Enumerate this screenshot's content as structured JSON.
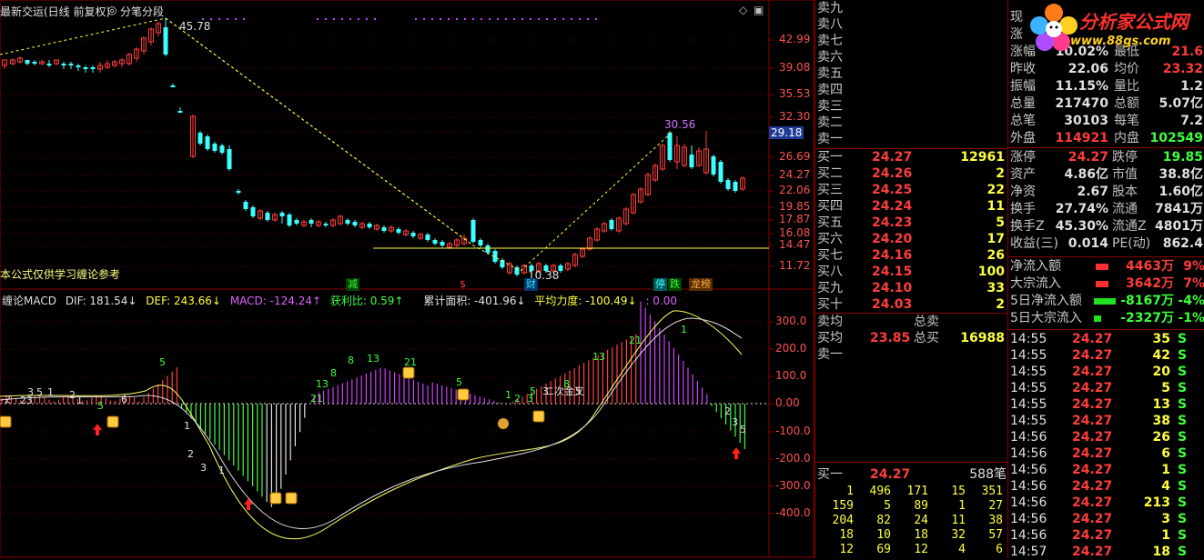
{
  "chart": {
    "header_title": "最新交运(日线 前复权)",
    "header_mode": "分笔分段",
    "notice": "本公式仅供学习缠论参考",
    "price_high_label": "45.78",
    "price_low_label": "10.38",
    "recent_high_label": "30.56",
    "current_price_tag": "29.18",
    "price_axis": [
      "42.99",
      "39.08",
      "35.53",
      "32.30",
      "29.18",
      "26.69",
      "24.27",
      "22.06",
      "19.85",
      "17.87",
      "16.08",
      "14.47",
      "11.72"
    ],
    "macd_axis": [
      "300.0",
      "200.0",
      "100.0",
      "0.00",
      "-100.0",
      "-200.0",
      "-300.0",
      "-400.0"
    ],
    "signal_tags": {
      "reduce": "减",
      "sell": "$",
      "fin": "财",
      "limit_up": "停",
      "drop": "跌",
      "dragon": "龙榜"
    },
    "macd_header": {
      "name": "缠论MACD",
      "dif": "DIF: 181.54↓",
      "def": "DEF: 243.66↓",
      "macd": "MACD: -124.24↑",
      "profit": "获利比: 0.59↑",
      "area": "累计面积: -401.96↓",
      "force": "平均力度: -100.49↓",
      "extra": ": 0.00"
    },
    "macd_annotations": [
      "5",
      "5",
      "8",
      "13",
      "21",
      "5",
      "8",
      "13",
      "21",
      "1",
      "2",
      "3",
      "5",
      "8",
      "13",
      "21",
      "1",
      "2",
      "3",
      "5",
      "1",
      "2",
      "3",
      "5",
      "二次金叉",
      "1",
      "2",
      "3",
      "1",
      "2",
      "3",
      "5",
      "6",
      "1",
      "23"
    ]
  },
  "orderbook": {
    "sell_labels": [
      "卖九",
      "卖八",
      "卖七",
      "卖六",
      "卖五",
      "卖四",
      "卖三",
      "卖二",
      "卖一"
    ],
    "buy_rows": [
      {
        "label": "买一",
        "price": "24.27",
        "vol": "12961"
      },
      {
        "label": "买二",
        "price": "24.26",
        "vol": "2"
      },
      {
        "label": "买三",
        "price": "24.25",
        "vol": "22"
      },
      {
        "label": "买四",
        "price": "24.24",
        "vol": "11"
      },
      {
        "label": "买五",
        "price": "24.23",
        "vol": "5"
      },
      {
        "label": "买六",
        "price": "24.20",
        "vol": "17"
      },
      {
        "label": "买七",
        "price": "24.16",
        "vol": "26"
      },
      {
        "label": "买八",
        "price": "24.15",
        "vol": "100"
      },
      {
        "label": "买九",
        "price": "24.10",
        "vol": "33"
      },
      {
        "label": "买十",
        "price": "24.03",
        "vol": "2"
      }
    ],
    "sell_avg_label": "卖均",
    "total_sell_label": "总卖",
    "buy_avg_label": "买均",
    "buy_avg_value": "23.85",
    "total_buy_label": "总买",
    "total_buy_value": "16988",
    "sell1_label": "卖一",
    "bottom_buy1_label": "买一",
    "bottom_buy1_price": "24.27",
    "bottom_buy1_count": "588笔",
    "queue": [
      [
        "1",
        "496",
        "171",
        "15",
        "351"
      ],
      [
        "159",
        "5",
        "89",
        "1",
        "27"
      ],
      [
        "204",
        "82",
        "24",
        "11",
        "38"
      ],
      [
        "18",
        "10",
        "18",
        "32",
        "57"
      ],
      [
        "12",
        "69",
        "12",
        "4",
        "6"
      ]
    ]
  },
  "quote": {
    "logo_text": "分析家公式网",
    "logo_url": "www.88gs.com",
    "rows": [
      {
        "a": "现",
        "b": "",
        "c": "",
        "d": ""
      },
      {
        "a": "涨",
        "b": "",
        "c": "",
        "d": ""
      },
      {
        "a": "涨幅",
        "b": "10.02%",
        "c": "最低",
        "d": "21.6"
      },
      {
        "a": "昨收",
        "b": "22.06",
        "c": "均价",
        "d": "23.32"
      },
      {
        "a": "振幅",
        "b": "11.15%",
        "c": "量比",
        "d": "1.2"
      },
      {
        "a": "总量",
        "b": "217470",
        "c": "总额",
        "d": "5.07亿"
      },
      {
        "a": "总笔",
        "b": "30103",
        "c": "每笔",
        "d": "7.2"
      },
      {
        "a": "外盘",
        "b": "114921",
        "c": "内盘",
        "d": "102549"
      }
    ],
    "rows2": [
      {
        "a": "涨停",
        "b": "24.27",
        "c": "跌停",
        "d": "19.85"
      },
      {
        "a": "资产",
        "b": "4.86亿",
        "c": "市值",
        "d": "38.8亿"
      },
      {
        "a": "净资",
        "b": "2.67",
        "c": "股本",
        "d": "1.60亿"
      },
      {
        "a": "换手",
        "b": "27.74%",
        "c": "流通",
        "d": "7841万"
      },
      {
        "a": "换手Z",
        "b": "45.30%",
        "c": "流通Z",
        "d": "4801万"
      },
      {
        "a": "收益(三)",
        "b": "0.014",
        "c": "PE(动)",
        "d": "862.4"
      }
    ],
    "flows": [
      {
        "label": "净流入额",
        "value": "4463万",
        "tail": "9%"
      },
      {
        "label": "大宗流入",
        "value": "3642万",
        "tail": "7%"
      },
      {
        "label": "5日净流入额",
        "value": "-8167万",
        "tail": "-4%"
      },
      {
        "label": "5日大宗流入",
        "value": "-2327万",
        "tail": "-1%"
      }
    ],
    "ticks": [
      {
        "t": "14:55",
        "p": "24.27",
        "v": "35",
        "s": "S"
      },
      {
        "t": "14:55",
        "p": "24.27",
        "v": "42",
        "s": "S"
      },
      {
        "t": "14:55",
        "p": "24.27",
        "v": "20",
        "s": "S"
      },
      {
        "t": "14:55",
        "p": "24.27",
        "v": "5",
        "s": "S"
      },
      {
        "t": "14:55",
        "p": "24.27",
        "v": "13",
        "s": "S"
      },
      {
        "t": "14:55",
        "p": "24.27",
        "v": "38",
        "s": "S"
      },
      {
        "t": "14:56",
        "p": "24.27",
        "v": "26",
        "s": "S"
      },
      {
        "t": "14:56",
        "p": "24.27",
        "v": "6",
        "s": "S"
      },
      {
        "t": "14:56",
        "p": "24.27",
        "v": "1",
        "s": "S"
      },
      {
        "t": "14:56",
        "p": "24.27",
        "v": "4",
        "s": "S"
      },
      {
        "t": "14:56",
        "p": "24.27",
        "v": "213",
        "s": "S"
      },
      {
        "t": "14:56",
        "p": "24.27",
        "v": "3",
        "s": "S"
      },
      {
        "t": "14:56",
        "p": "24.27",
        "v": "1",
        "s": "S"
      },
      {
        "t": "14:57",
        "p": "24.27",
        "v": "18",
        "s": "S"
      }
    ]
  },
  "colors": {
    "up": "#ff3c3c",
    "down": "#3cffff",
    "grid": "#880000",
    "yellow": "#ffff40"
  }
}
